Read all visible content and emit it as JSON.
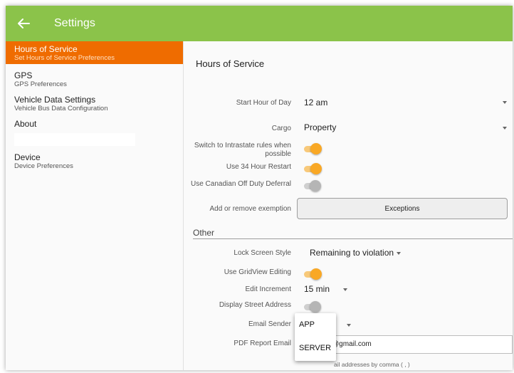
{
  "appbar": {
    "title": "Settings",
    "back_icon": "arrow-left-icon"
  },
  "sidebar": {
    "items": [
      {
        "title": "Hours of Service",
        "subtitle": "Set Hours of Service Preferences",
        "active": true
      },
      {
        "title": "GPS",
        "subtitle": "GPS Preferences",
        "active": false
      },
      {
        "title": "Vehicle Data Settings",
        "subtitle": "Vehicle Bus Data Configuration",
        "active": false
      },
      {
        "title": "About",
        "subtitle": "",
        "active": false
      },
      {
        "title": "Device",
        "subtitle": "Device Preferences",
        "active": false
      }
    ]
  },
  "main": {
    "section_title": "Hours of Service",
    "start_hour": {
      "label": "Start Hour of Day",
      "value": "12 am"
    },
    "cargo": {
      "label": "Cargo",
      "value": "Property"
    },
    "intrastate": {
      "label_line1": "Switch to Intrastate rules when",
      "label_line2": "possible",
      "on": true
    },
    "restart34": {
      "label": "Use 34 Hour Restart",
      "on": true
    },
    "canadian_deferral": {
      "label": "Use Canadian Off Duty Deferral",
      "on": false
    },
    "exemption": {
      "label": "Add or remove exemption",
      "button": "Exceptions"
    },
    "other": {
      "header": "Other",
      "lock_screen": {
        "label": "Lock Screen Style",
        "value": "Remaining to violation"
      },
      "gridview": {
        "label": "Use GridView Editing",
        "on": true
      },
      "edit_increment": {
        "label": "Edit Increment",
        "value": "15 min"
      },
      "street_address": {
        "label": "Display Street Address",
        "on": false
      },
      "email_sender": {
        "label": "Email Sender"
      },
      "pdf_email": {
        "label": "PDF Report Email",
        "value": "@gmail.com"
      },
      "hint": "ail addresses by comma ( , )"
    }
  },
  "popup": {
    "options": [
      "APP",
      "SERVER"
    ]
  },
  "colors": {
    "appbar": "#8bc34a",
    "active": "#ef6c00",
    "switch_on": "#f9a825"
  }
}
